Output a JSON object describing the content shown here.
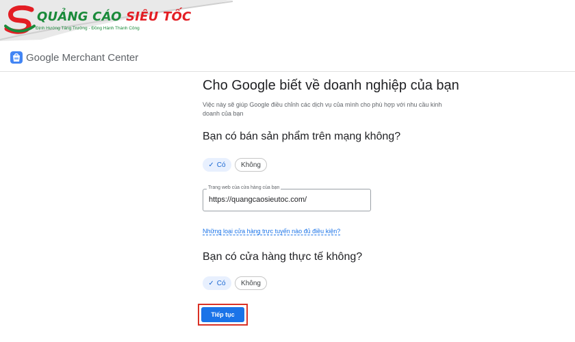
{
  "banner": {
    "brand_part1": "QUẢNG CÁO",
    "brand_part2": "SIÊU TỐC",
    "tagline": "Định Hướng Tăng Trưởng - Đồng Hành Thành Công"
  },
  "header": {
    "app_title": "Google Merchant Center",
    "logo_icon": "merchant-center-bag-icon"
  },
  "main": {
    "title": "Cho Google biết về doanh nghiệp của bạn",
    "description": "Việc này sẽ giúp Google điều chỉnh các dịch vụ của mình cho phù hợp với nhu cầu kinh doanh của bạn",
    "online_question": {
      "label": "Bạn có bán sản phẩm trên mạng không?",
      "options": [
        "Có",
        "Không"
      ],
      "selected": "Có"
    },
    "website_field": {
      "label": "Trang web của cửa hàng của bạn",
      "value": "https://quangcaosieutoc.com/"
    },
    "help_link": "Những loại cửa hàng trực tuyến nào đủ điều kiện?",
    "physical_question": {
      "label": "Bạn có cửa hàng thực tế không?",
      "options": [
        "Có",
        "Không"
      ],
      "selected": "Có"
    },
    "continue_label": "Tiếp tục"
  },
  "colors": {
    "accent": "#1a73e8",
    "chip_selected_bg": "#e8f0fe",
    "highlight_border": "#d93025",
    "brand_green": "#1a8a3a",
    "brand_red": "#e31e24"
  }
}
